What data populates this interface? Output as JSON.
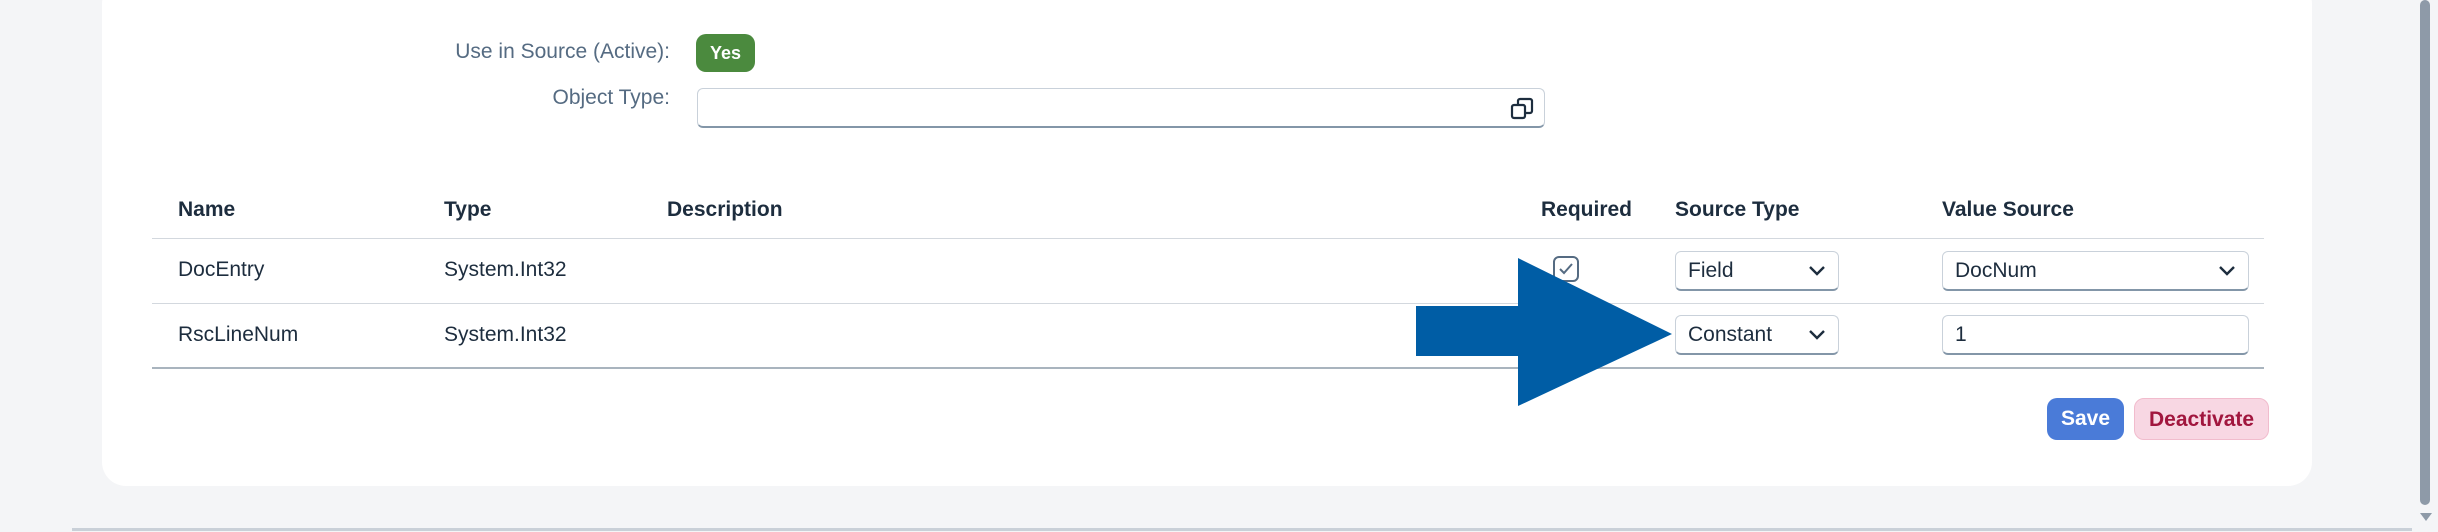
{
  "form": {
    "use_in_source_label": "Use in Source (Active):",
    "use_in_source_value": "Yes",
    "object_type_label": "Object Type:",
    "object_type_value": ""
  },
  "table": {
    "headers": [
      "Name",
      "Type",
      "Description",
      "Required",
      "Source Type",
      "Value Source"
    ],
    "rows": [
      {
        "name": "DocEntry",
        "type": "System.Int32",
        "description": "",
        "required": true,
        "source_type": "Field",
        "value_source": "DocNum"
      },
      {
        "name": "RscLineNum",
        "type": "System.Int32",
        "description": "",
        "required": false,
        "source_type": "Constant",
        "value_source": "1"
      }
    ]
  },
  "actions": {
    "save_label": "Save",
    "deactivate_label": "Deactivate"
  },
  "colors": {
    "accent": "#4a7bd8",
    "badge_green": "#4b8a3e",
    "arrow_blue": "#005da5",
    "deactivate_text": "#a1163e"
  },
  "icons": {
    "value_help": "value-help-icon",
    "dropdown": "chevron-down-icon",
    "checkbox": "checkmark-icon",
    "annotation": "arrow-right-icon"
  }
}
